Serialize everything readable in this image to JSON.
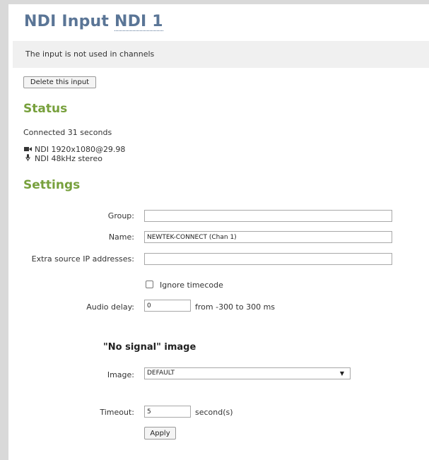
{
  "header": {
    "title_prefix": "NDI Input ",
    "title_source": "NDI 1"
  },
  "notice": "The input is not used in channels",
  "actions": {
    "delete_label": "Delete this input"
  },
  "status": {
    "heading": "Status",
    "connected": "Connected 31 seconds",
    "video": "NDI 1920x1080@29.98",
    "audio": "NDI 48kHz stereo",
    "icons": {
      "video": "video-camera-icon",
      "audio": "microphone-icon"
    }
  },
  "settings": {
    "heading": "Settings",
    "group": {
      "label": "Group:",
      "value": ""
    },
    "name": {
      "label": "Name:",
      "value": "NEWTEK-CONNECT (Chan 1)"
    },
    "extra_ip": {
      "label": "Extra source IP addresses:",
      "value": ""
    },
    "ignore_timecode": {
      "label": "Ignore timecode",
      "checked": false
    },
    "audio_delay": {
      "label": "Audio delay:",
      "value": "0",
      "range_hint": "from -300 to 300 ms"
    }
  },
  "no_signal": {
    "heading": "\"No signal\" image",
    "image": {
      "label": "Image:",
      "value": "DEFAULT"
    },
    "timeout": {
      "label": "Timeout:",
      "value": "5",
      "unit": "second(s)"
    },
    "apply_label": "Apply"
  },
  "colors": {
    "title": "#5a7596",
    "section": "#77a03c",
    "notice_bg": "#f0f0f0",
    "frame": "#d9d9d9"
  }
}
